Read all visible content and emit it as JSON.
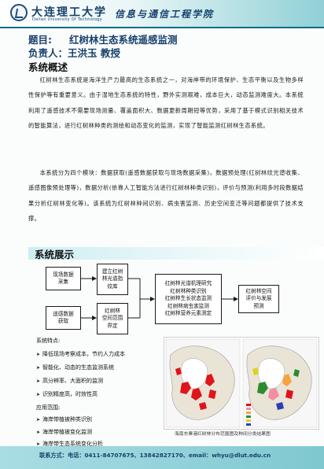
{
  "header": {
    "university_cn": "大连理工大学",
    "university_en": "Dalian University Of Technology",
    "school": "信息与通信工程学院"
  },
  "title": {
    "label": "题目:",
    "text": "红树林生态系统遥感监测"
  },
  "person": {
    "label": "负责人：",
    "name": "王洪玉 教授"
  },
  "overview": {
    "heading": "系统概述",
    "paragraphs": [
      "红树林生态系统是海洋生产力最高的生态系统之一，对海岸带的环境保护、生态平衡以及生物多样性保护等有重要意义。由于湿地生态系统的特性，野外实测艰难，成本巨大，动态监测难度大。本系统利用了遥感技术不需要现场测量、覆盖面积大、数据更新周期短等优势，采用了基于模式识别相关技术的智能算法，进行红树林种类的测绘和动态变化的监测，实现了智能监测红树林生态系统。",
      "本系统分为四个模块：数据获取(遥感数据获取与现场数据采集)，数据预处理(红树林纹光谱收集、遥感图像预处理等)，数据分析(依靠人工智能方法进行红树林种类识别)，评价与预测(利用多时段数据结果分析红树林变化等)。该系统为红树林种间识别、病虫害监测、历史空间变迁等问题都提供了技术支撑。"
    ]
  },
  "showcase": {
    "heading": "系统展示"
  },
  "flowchart": {
    "field_collect": [
      "现场数据",
      "采集"
    ],
    "rs_acquire": [
      "遥感数据",
      "获取"
    ],
    "spectral_lib": [
      "建立红树",
      "林光谱指",
      "纹库"
    ],
    "spatial_extent": [
      "红树林",
      "空间范围",
      "界定"
    ],
    "functions": [
      "红树林光谱机理研究",
      "红树林种类识别",
      "红树林生长状态监测",
      "红树林病虫害监测",
      "红树林营养元素测定"
    ],
    "result": [
      "红树林空间",
      "评价与发展",
      "预测"
    ]
  },
  "features": {
    "heading": "系统特点:",
    "items": [
      "降低现场考察成本，节约人力成本",
      "智能化、动态的生态监测系统",
      "高分辨率、大面积的监测",
      "识别精度高，时效性高"
    ]
  },
  "applications": {
    "heading": "应用范围:",
    "items": [
      "海岸带植被种类识别",
      "海岸带植被变化监测",
      "海岸带生态系统变化分析"
    ]
  },
  "map": {
    "caption": "海南东寨港红树林分布范围图及种间分类结果图",
    "colors": {
      "sea": "#ffffff",
      "land": "#e9e4d6",
      "mangrove_red": "#e0141b",
      "mangrove_pink": "#f28ea4",
      "mangrove_orange": "#f4a340",
      "mangrove_green": "#2e8b2e",
      "mangrove_yellow": "#d9d419",
      "mangrove_blue": "#2f3fb3"
    }
  },
  "footer": {
    "contact": "联系方式：电话：0411-84707675、13842827170、email：whyu@dlut.edu.cn"
  },
  "colors": {
    "accent": "#16406b",
    "header_rule": "#0f6b8a",
    "footer_bg": "#7fc8d0"
  }
}
